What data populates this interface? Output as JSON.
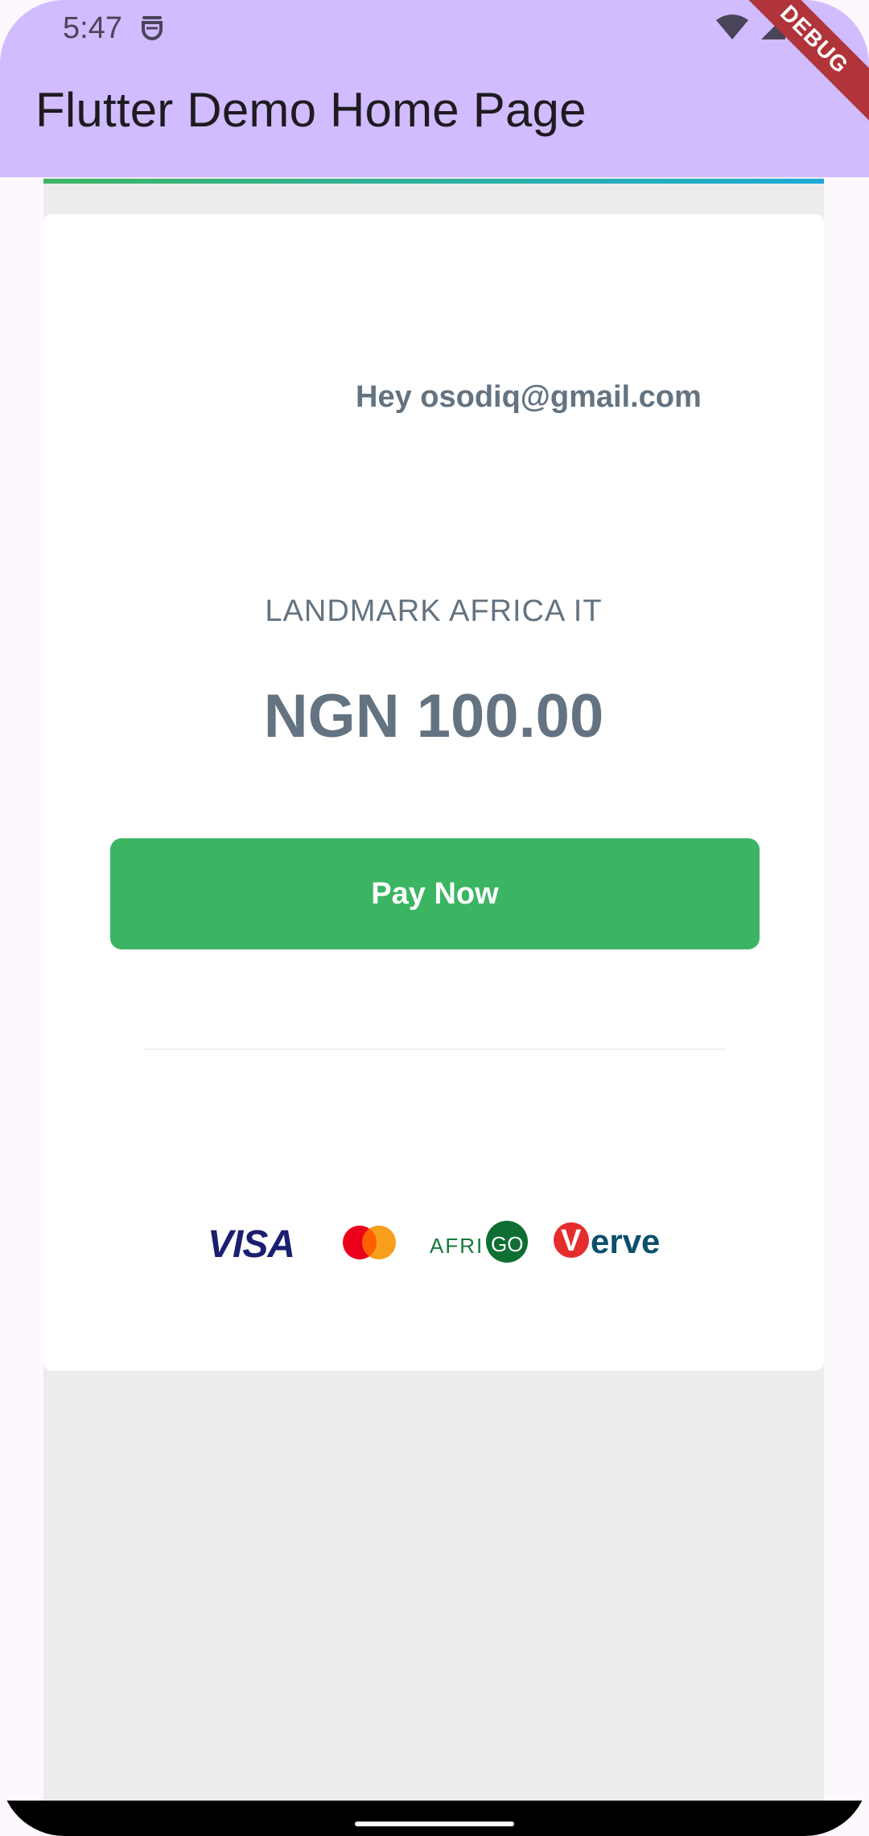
{
  "status_bar": {
    "time": "5:47"
  },
  "app_bar": {
    "title": "Flutter Demo Home Page",
    "debug_label": "DEBUG"
  },
  "checkout": {
    "greeting": "Hey osodiq@gmail.com",
    "merchant": "LANDMARK AFRICA IT",
    "amount": "NGN 100.00",
    "pay_button": "Pay Now"
  },
  "payment_logos": {
    "visa": "VISA",
    "afrigo_text": "AFRI",
    "afrigo_go": "GO",
    "verve_v": "V",
    "verve_rest": "erve"
  },
  "colors": {
    "app_bar": "#d0bcfe",
    "accent_green": "#3cb563",
    "text_gray": "#637381",
    "debug_red": "#b0343a"
  }
}
